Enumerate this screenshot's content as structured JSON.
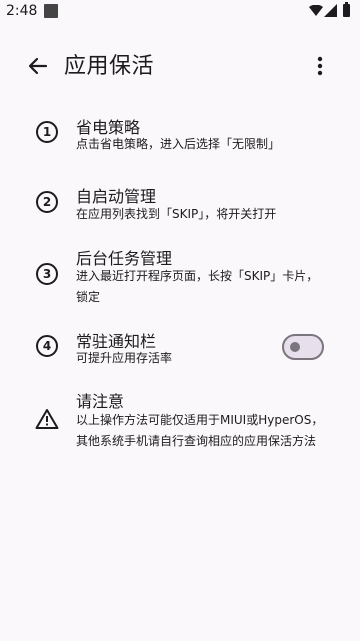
{
  "status_bar": {
    "time": "2:48"
  },
  "app_bar": {
    "title": "应用保活"
  },
  "items": [
    {
      "number": "1",
      "title": "省电策略",
      "desc": "点击省电策略，进入后选择「无限制」"
    },
    {
      "number": "2",
      "title": "自启动管理",
      "desc": "在应用列表找到「SKIP」，将开关打开"
    },
    {
      "number": "3",
      "title": "后台任务管理",
      "desc": "进入最近打开程序页面，长按「SKIP」卡片，锁定"
    },
    {
      "number": "4",
      "title": "常驻通知栏",
      "desc": "可提升应用存活率",
      "toggle_on": false
    }
  ],
  "notice": {
    "title": "请注意",
    "desc": "以上操作方法可能仅适用于MIUI或HyperOS，其他系统手机请自行查询相应的应用保活方法"
  },
  "icons": {
    "back": "arrow-back-icon",
    "more": "more-vert-icon",
    "warning": "warning-icon",
    "wifi": "wifi-icon",
    "signal": "signal-icon",
    "battery": "battery-icon"
  },
  "colors": {
    "background": "#fbf8fb",
    "text": "#1c1b1f",
    "toggle_outline": "#7a757f",
    "toggle_track": "#e7e0ec"
  }
}
